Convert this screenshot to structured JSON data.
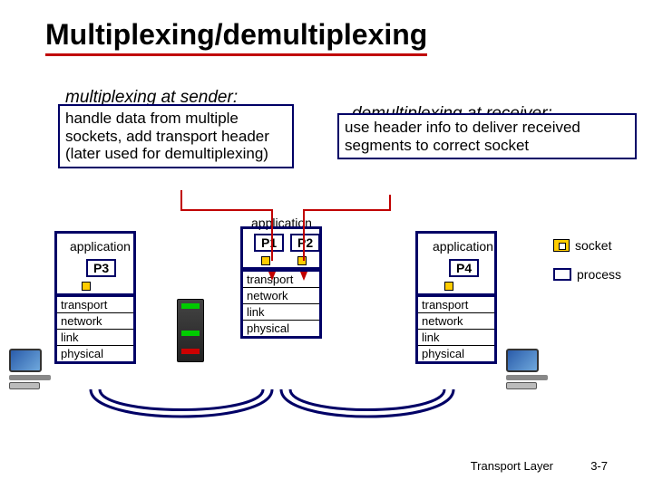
{
  "title": "Multiplexing/demultiplexing",
  "sender": {
    "header": "multiplexing at sender:",
    "body": "handle data from multiple sockets, add transport header (later used for demultiplexing)"
  },
  "receiver": {
    "header": "demultiplexing at receiver:",
    "body": "use header info to deliver received segments to correct socket"
  },
  "stack_labels": {
    "application": "application",
    "transport": "transport",
    "network": "network",
    "link": "link",
    "physical": "physical"
  },
  "processes": {
    "p1": "P1",
    "p2": "P2",
    "p3": "P3",
    "p4": "P4"
  },
  "legend": {
    "socket": "socket",
    "process": "process"
  },
  "footer": {
    "layer": "Transport Layer",
    "page": "3-7"
  }
}
